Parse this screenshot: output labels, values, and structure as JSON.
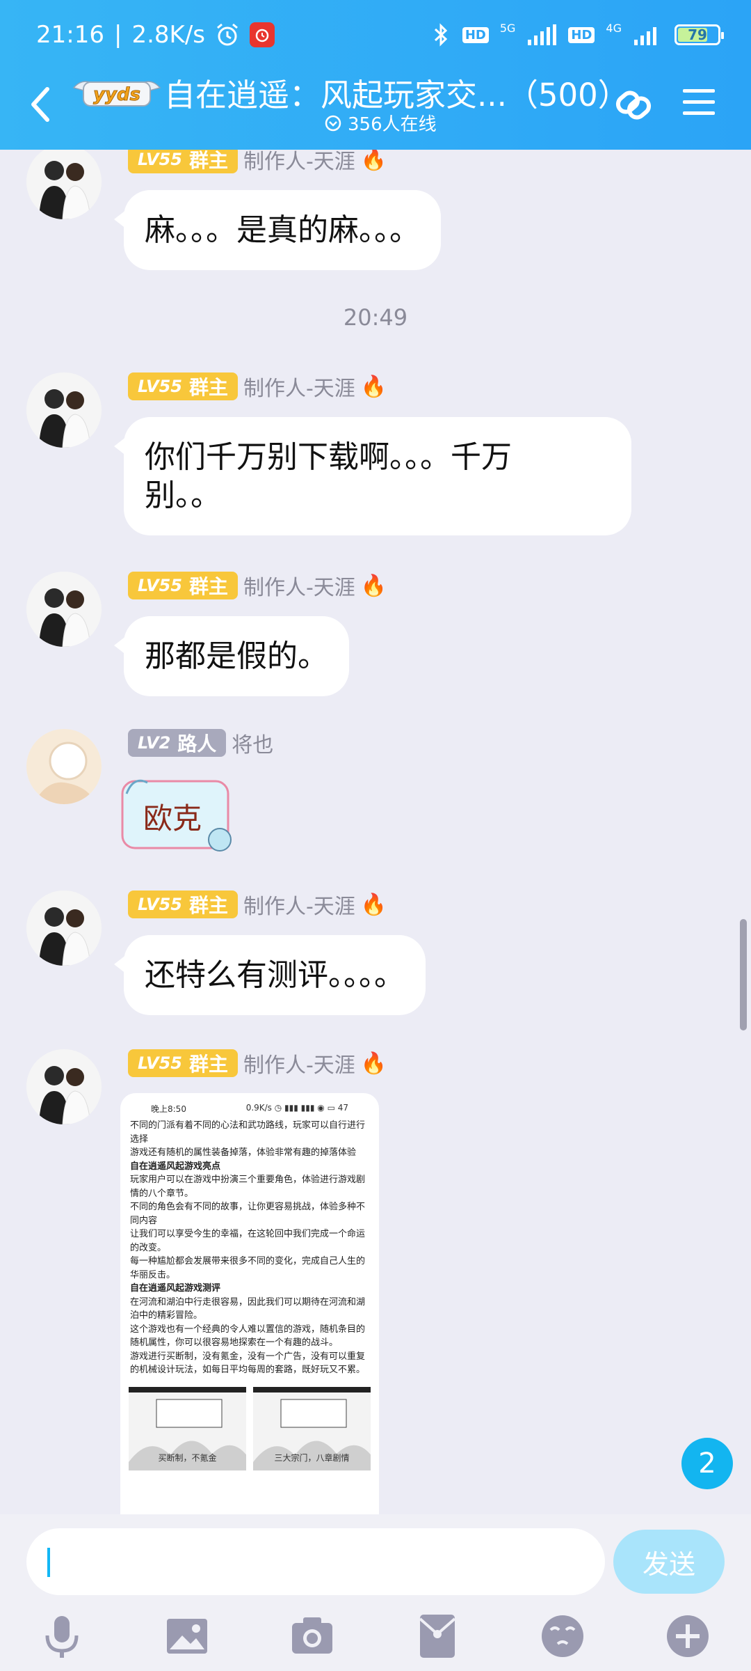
{
  "status_bar": {
    "time": "21:16",
    "separator": "|",
    "speed": "2.8K/s",
    "hd1": "HD",
    "net1": "5G",
    "hd2": "HD",
    "net2": "4G",
    "battery": "79"
  },
  "header": {
    "logo_text": "yyds",
    "title": "自在逍遥：风起玩家交...（500）",
    "online": "356人在线"
  },
  "messages": [
    {
      "badge_lv": "LV55",
      "badge_role": "群主",
      "nick": "制作人-天涯",
      "text": "麻。。。是真的麻。。。"
    },
    {
      "badge_lv": "LV55",
      "badge_role": "群主",
      "nick": "制作人-天涯",
      "text_line1": "你们千万别下载啊。。。千万",
      "text_line2": "别。。"
    },
    {
      "badge_lv": "LV55",
      "badge_role": "群主",
      "nick": "制作人-天涯",
      "text": "那都是假的。"
    },
    {
      "badge_lv": "LV2",
      "badge_role": "路人",
      "nick": "将也",
      "sticker_text": "欧克"
    },
    {
      "badge_lv": "LV55",
      "badge_role": "群主",
      "nick": "制作人-天涯",
      "text": "还特么有测评。。。。"
    },
    {
      "badge_lv": "LV55",
      "badge_role": "群主",
      "nick": "制作人-天涯"
    }
  ],
  "timestamp": "20:49",
  "screenshot_preview": {
    "status_left": "晚上8:50",
    "status_right": "0.9K/s ◷ ▮▮▮ ▮▮▮ ◉ ▭ 47",
    "lines": [
      {
        "t": "不同的门派有着不同的心法和武功路线，玩家可以自行进行",
        "bold": false
      },
      {
        "t": "选择",
        "bold": false
      },
      {
        "t": "游戏还有随机的属性装备掉落，体验非常有趣的掉落体验",
        "bold": false
      },
      {
        "t": "自在逍遥风起游戏亮点",
        "bold": true
      },
      {
        "t": "玩家用户可以在游戏中扮演三个重要角色，体验进行游戏剧",
        "bold": false
      },
      {
        "t": "情的八个章节。",
        "bold": false
      },
      {
        "t": "不同的角色会有不同的故事，让你更容易挑战，体验多种不",
        "bold": false
      },
      {
        "t": "同内容",
        "bold": false
      },
      {
        "t": "让我们可以享受今生的幸福，在这轮回中我们完成一个命运",
        "bold": false
      },
      {
        "t": "的改变。",
        "bold": false
      },
      {
        "t": "每一种尴尬都会发展带来很多不同的变化，完成自己人生的",
        "bold": false
      },
      {
        "t": "华丽反击。",
        "bold": false
      },
      {
        "t": "自在逍遥风起游戏测评",
        "bold": true
      },
      {
        "t": "在河流和湖泊中行走很容易，因此我们可以期待在河流和湖",
        "bold": false
      },
      {
        "t": "泊中的精彩冒险。",
        "bold": false
      },
      {
        "t": "这个游戏也有一个经典的令人难以置信的游戏，随机条目的",
        "bold": false
      },
      {
        "t": "随机属性，你可以很容易地探索在一个有趣的战斗。",
        "bold": false
      },
      {
        "t": "游戏进行买断制，没有氪金，没有一个广告，没有可以重复",
        "bold": false
      },
      {
        "t": "的机械设计玩法，如每日平均每周的套路，既好玩又不累。",
        "bold": false
      }
    ],
    "img1_caption": "买断制，不氪金",
    "img2_caption": "三大宗门，八章剧情"
  },
  "unread_count": "2",
  "input": {
    "placeholder": "",
    "send_label": "发送"
  },
  "toolbar": [
    "voice-icon",
    "image-icon",
    "camera-icon",
    "red-packet-icon",
    "emoji-icon",
    "plus-icon"
  ],
  "colors": {
    "header_blue": "#2ba4f6",
    "gold_badge": "#f8c73b",
    "gray_badge": "#a8a9bc",
    "accent": "#12b7f5"
  }
}
